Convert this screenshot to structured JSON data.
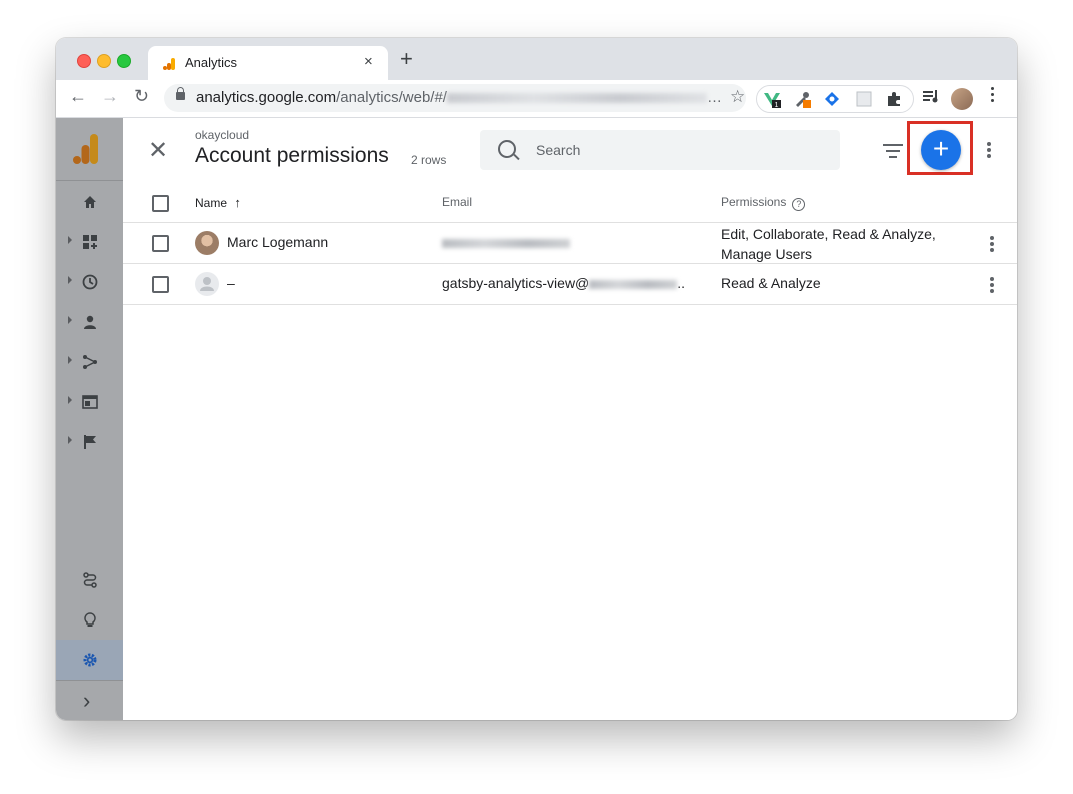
{
  "browser": {
    "tab_title": "Analytics",
    "tab_close": "×",
    "new_tab": "+",
    "url_host": "analytics.google.com",
    "url_path": "/analytics/web/#/",
    "url_ellipsis": "…",
    "extension_badge": "1",
    "back": "←",
    "forward": "→",
    "reload": "↻",
    "star": "☆"
  },
  "header": {
    "account_name": "okaycloud",
    "title": "Account permissions",
    "rows_count": "2 rows",
    "search_placeholder": "Search",
    "add_label": "+",
    "close_label": "✕"
  },
  "table": {
    "columns": [
      "Name",
      "Email",
      "Permissions"
    ],
    "sort_indicator": "↑",
    "help_icon": "?",
    "rows": [
      {
        "name": "Marc Logemann",
        "email": "",
        "permissions_line1": "Edit, Collaborate, Read & Analyze,",
        "permissions_line2": "Manage Users"
      },
      {
        "name": "–",
        "email_prefix": "gatsby-analytics-view@",
        "email_suffix": "..",
        "permissions_line1": "Read & Analyze"
      }
    ]
  },
  "sidebar": {
    "items": [
      "home-icon",
      "dashboard-icon",
      "realtime-icon",
      "audience-icon",
      "acquisition-icon",
      "behavior-icon",
      "conversions-icon",
      "attribution-icon",
      "discover-icon",
      "admin-icon",
      "expand-icon"
    ],
    "expand_label": "›"
  },
  "colors": {
    "accent": "#1a73e8",
    "highlight": "#d93025",
    "sidebar": "#a6a8ab"
  }
}
